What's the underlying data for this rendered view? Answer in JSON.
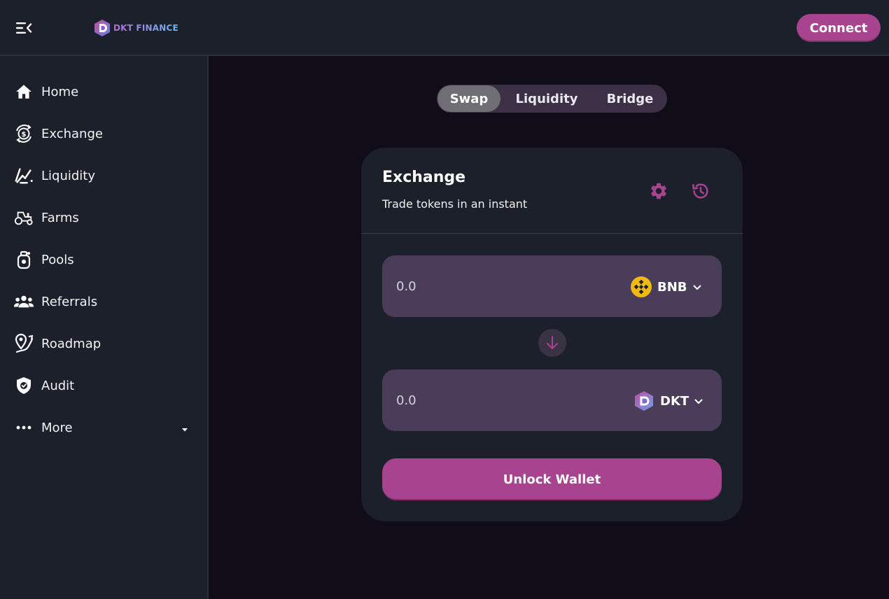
{
  "header": {
    "logo_text": "DKT FINANCE",
    "connect_label": "Connect",
    "menu_icon": "menu-collapse-icon"
  },
  "sidebar": {
    "items": [
      {
        "label": "Home",
        "icon": "home-icon"
      },
      {
        "label": "Exchange",
        "icon": "exchange-icon"
      },
      {
        "label": "Liquidity",
        "icon": "liquidity-icon"
      },
      {
        "label": "Farms",
        "icon": "tractor-icon"
      },
      {
        "label": "Pools",
        "icon": "pool-icon"
      },
      {
        "label": "Referrals",
        "icon": "group-icon"
      },
      {
        "label": "Roadmap",
        "icon": "roadmap-icon"
      },
      {
        "label": "Audit",
        "icon": "shield-check-icon"
      },
      {
        "label": "More",
        "icon": "more-dots-icon"
      }
    ]
  },
  "tabs": [
    {
      "label": "Swap",
      "active": true
    },
    {
      "label": "Liquidity",
      "active": false
    },
    {
      "label": "Bridge",
      "active": false
    }
  ],
  "exchange": {
    "title": "Exchange",
    "subtitle": "Trade tokens in an instant",
    "settings_icon": "gear-icon",
    "history_icon": "history-icon",
    "from": {
      "placeholder": "0.0",
      "token": "BNB",
      "token_icon": "bnb-token-icon"
    },
    "to": {
      "placeholder": "0.0",
      "token": "DKT",
      "token_icon": "dkt-token-icon"
    },
    "swap_icon": "arrow-down-icon",
    "unlock_label": "Unlock Wallet"
  },
  "colors": {
    "accent": "#a8448f",
    "background": "#100d19",
    "panel": "#1b202a",
    "input_bg": "#4a3d59"
  }
}
